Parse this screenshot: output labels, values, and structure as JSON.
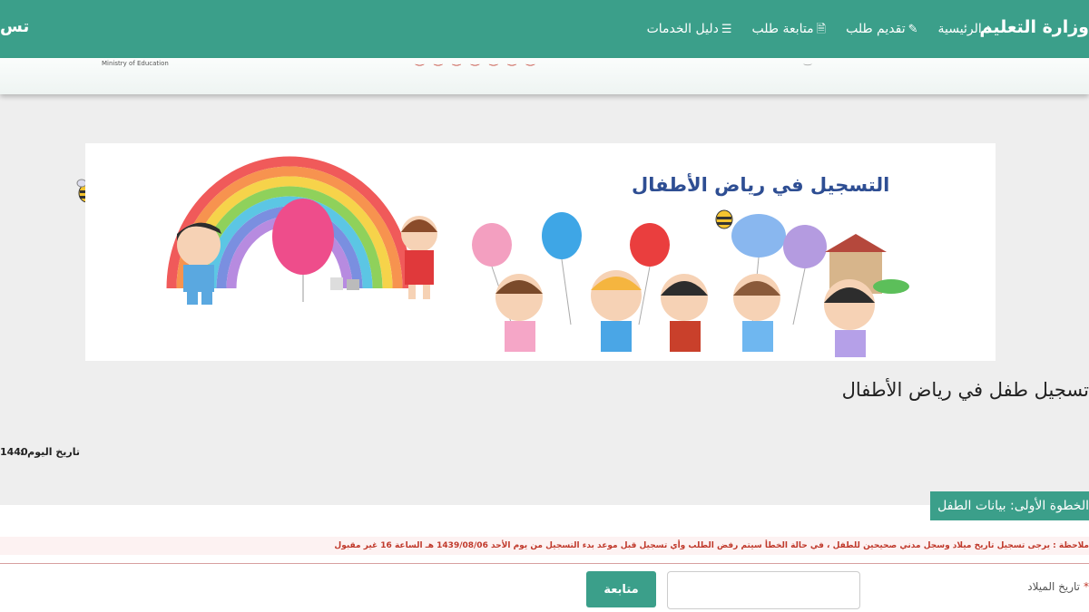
{
  "header": {
    "brand": "وزارة التعليم",
    "left_fragment": "تس",
    "nav": [
      {
        "label": "الرئيسية",
        "icon": "home-icon"
      },
      {
        "label": "تقديم طلب",
        "icon": "edit-icon"
      },
      {
        "label": "متابعة طلب",
        "icon": "file-icon"
      },
      {
        "label": "دليل الخدمات",
        "icon": "list-icon"
      }
    ]
  },
  "subheader": {
    "ministry_en": "Ministry of Education"
  },
  "banner": {
    "title": "التسجيل في رياض الأطفال"
  },
  "page": {
    "title": "تسجيل طفل في رياض الأطفال",
    "date_label": "تاريخ اليوم :",
    "date_value": "1440"
  },
  "step": {
    "label": "الخطوة الأولى: بيانات الطفل"
  },
  "notice": {
    "text": "ملاحظة : يرجى تسجيل تاريخ ميلاد وسجل مدني صحيحين للطفل ، في حالة الخطأ سيتم رفض الطلب وأي تسجيل قبل موعد بدء التسجيل من يوم الأحد 1439/08/06 هـ الساعة 16 غير مقبول"
  },
  "form": {
    "birth_label": "تاريخ الميلاد",
    "required_mark": "*",
    "birth_value": "",
    "next_label": "متابعة"
  },
  "colors": {
    "primary": "#3b9f8a",
    "notice_red": "#c0392b",
    "banner_title": "#2e4e93"
  }
}
